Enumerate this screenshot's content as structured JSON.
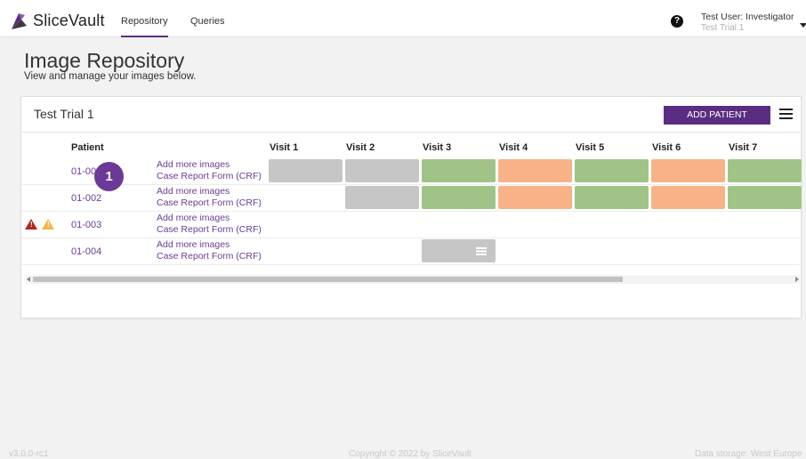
{
  "app": {
    "name": "SliceVault"
  },
  "nav": {
    "tabs": [
      {
        "label": "Repository",
        "active": true
      },
      {
        "label": "Queries",
        "active": false
      }
    ]
  },
  "user": {
    "name": "Test User: Investigator",
    "trial": "Test Trial 1"
  },
  "page": {
    "title": "Image Repository",
    "subtitle": "View and manage your images below."
  },
  "card": {
    "title": "Test Trial 1",
    "add_button": "ADD PATIENT",
    "columns": [
      "Patient",
      "Visit 1",
      "Visit 2",
      "Visit 3",
      "Visit 4",
      "Visit 5",
      "Visit 6",
      "Visit 7"
    ],
    "rows": [
      {
        "id": "01-001",
        "link1": "Add more images",
        "link2": "Case Report Form (CRF)",
        "visits": [
          "grey",
          "grey",
          "green",
          "orange",
          "green",
          "orange",
          "green"
        ]
      },
      {
        "id": "01-002",
        "link1": "Add more images",
        "link2": "Case Report Form (CRF)",
        "visits": [
          "",
          "grey",
          "green",
          "orange",
          "green",
          "orange",
          "green"
        ]
      },
      {
        "id": "01-003",
        "link1": "Add more images",
        "link2": "Case Report Form (CRF)",
        "visits": [
          "",
          "",
          "",
          "",
          "",
          "",
          ""
        ],
        "warnings": [
          "error",
          "warning"
        ]
      },
      {
        "id": "01-004",
        "link1": "Add more images",
        "link2": "Case Report Form (CRF)",
        "visits": [
          "",
          "",
          "grey-list",
          "",
          "",
          "",
          ""
        ]
      }
    ]
  },
  "badge": "1",
  "colors": {
    "accent": "#5a2d82",
    "green": "#a0c487",
    "orange": "#f8b287",
    "grey": "#c6c6c6",
    "error": "#b0271e",
    "warning": "#f2b544"
  },
  "footer": {
    "version": "v3.0.0-rc1",
    "copyright": "Copyright © 2022 by SliceVault",
    "storage": "Data storage: West Europe"
  }
}
